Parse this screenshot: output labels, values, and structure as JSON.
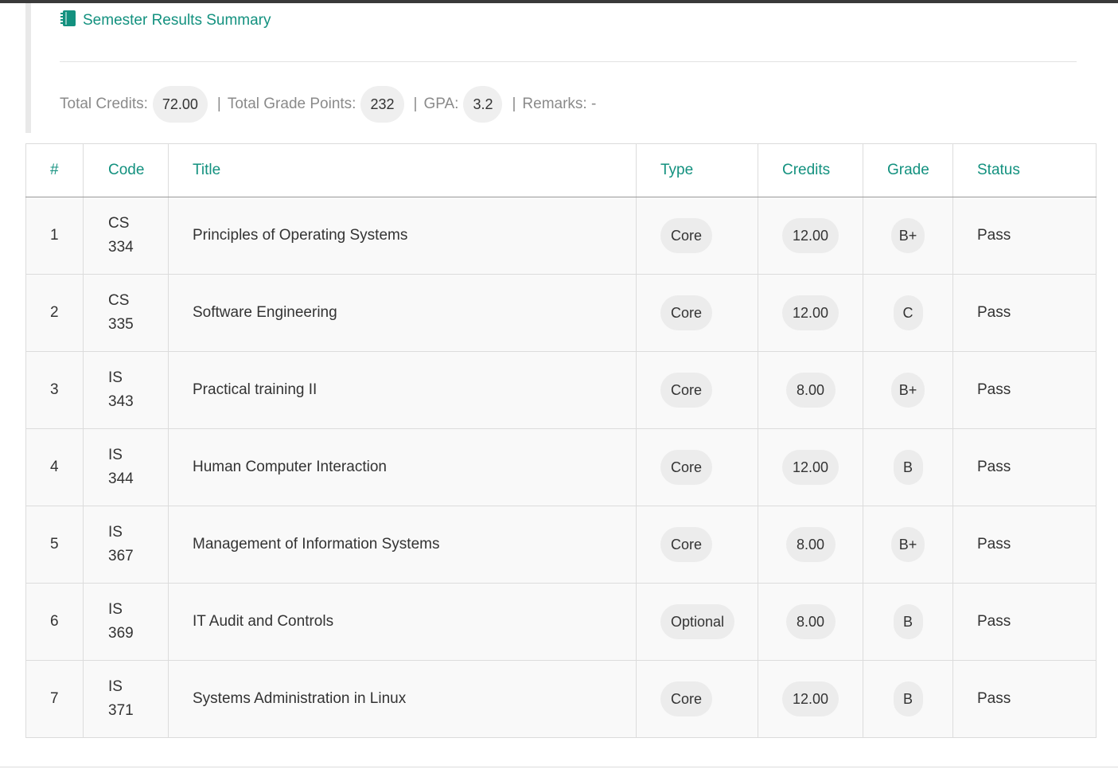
{
  "panel": {
    "title": "Semester Results Summary",
    "icon": "notebook-icon",
    "accent_color": "#13917f"
  },
  "summary": {
    "total_credits_label": "Total Credits:",
    "total_credits": "72.00",
    "total_grade_points_label": "Total Grade Points:",
    "total_grade_points": "232",
    "gpa_label": "GPA:",
    "gpa": "3.2",
    "remarks_label": "Remarks: -",
    "separator": "|"
  },
  "table": {
    "headers": [
      "#",
      "Code",
      "Title",
      "Type",
      "Credits",
      "Grade",
      "Status"
    ],
    "rows": [
      {
        "num": "1",
        "code_prefix": "CS",
        "code_number": "334",
        "title": "Principles of Operating Systems",
        "type": "Core",
        "credits": "12.00",
        "grade": "B+",
        "status": "Pass"
      },
      {
        "num": "2",
        "code_prefix": "CS",
        "code_number": "335",
        "title": "Software Engineering",
        "type": "Core",
        "credits": "12.00",
        "grade": "C",
        "status": "Pass"
      },
      {
        "num": "3",
        "code_prefix": "IS",
        "code_number": "343",
        "title": "Practical training II",
        "type": "Core",
        "credits": "8.00",
        "grade": "B+",
        "status": "Pass"
      },
      {
        "num": "4",
        "code_prefix": "IS",
        "code_number": "344",
        "title": "Human Computer Interaction",
        "type": "Core",
        "credits": "12.00",
        "grade": "B",
        "status": "Pass"
      },
      {
        "num": "5",
        "code_prefix": "IS",
        "code_number": "367",
        "title": "Management of Information Systems",
        "type": "Core",
        "credits": "8.00",
        "grade": "B+",
        "status": "Pass"
      },
      {
        "num": "6",
        "code_prefix": "IS",
        "code_number": "369",
        "title": "IT Audit and Controls",
        "type": "Optional",
        "credits": "8.00",
        "grade": "B",
        "status": "Pass"
      },
      {
        "num": "7",
        "code_prefix": "IS",
        "code_number": "371",
        "title": "Systems Administration in Linux",
        "type": "Core",
        "credits": "12.00",
        "grade": "B",
        "status": "Pass"
      }
    ]
  }
}
